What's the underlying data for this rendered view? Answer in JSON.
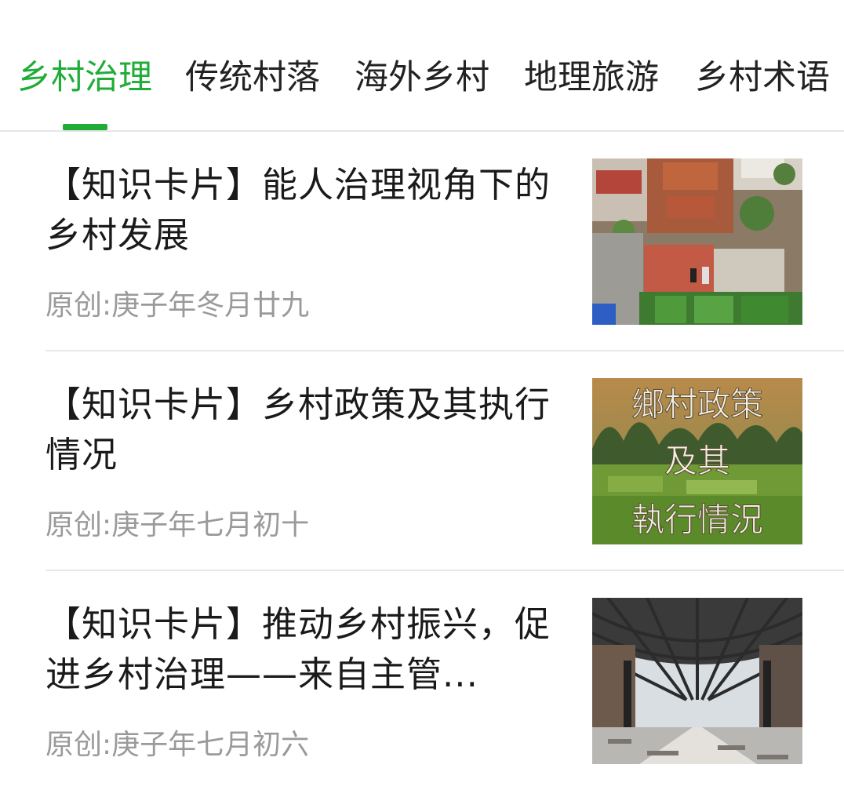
{
  "tabs": [
    {
      "label": "乡村治理",
      "active": true
    },
    {
      "label": "传统村落",
      "active": false
    },
    {
      "label": "海外乡村",
      "active": false
    },
    {
      "label": "地理旅游",
      "active": false
    },
    {
      "label": "乡村术语",
      "active": false
    }
  ],
  "accent_color": "#1fad37",
  "articles": [
    {
      "title": "【知识卡片】能人治理视角下的乡村发展",
      "meta": "原创:庚子年冬月廿九",
      "thumbnail": "aerial-village-photo"
    },
    {
      "title": "【知识卡片】乡村政策及其执行情况",
      "meta": "原创:庚子年七月初十",
      "thumbnail": "karst-landscape-photo",
      "thumbnail_text": [
        "鄉村政策",
        "及其",
        "執行情況"
      ]
    },
    {
      "title": "【知识卡片】推动乡村振兴，促进乡村治理——来自主管...",
      "meta": "原创:庚子年七月初六",
      "thumbnail": "steel-corridor-photo"
    }
  ]
}
